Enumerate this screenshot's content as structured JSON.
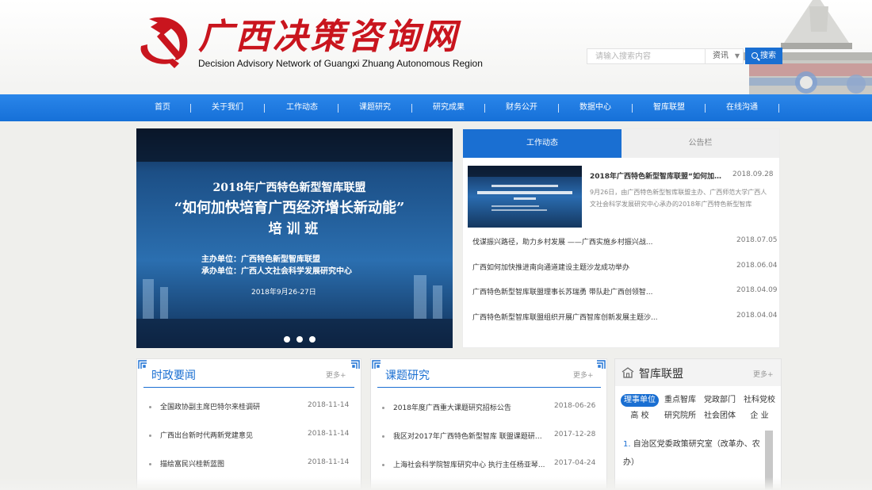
{
  "header": {
    "site_title": "广西决策咨询网",
    "site_subtitle": "Decision Advisory Network of Guangxi Zhuang Autonomous Region",
    "emblem_icon": "hammer-sickle-icon",
    "search": {
      "placeholder": "请输入搜索内容",
      "category": "资讯",
      "button_label": "搜索",
      "button_icon": "search-icon"
    }
  },
  "nav": {
    "items": [
      "首页",
      "关于我们",
      "工作动态",
      "课题研究",
      "研究成果",
      "财务公开",
      "数据中心",
      "智库联盟",
      "在线沟通"
    ]
  },
  "colors": {
    "accent": "#1a6fd2",
    "brand_red": "#c9151e"
  },
  "hero": {
    "line1": "2018年广西特色新型智库联盟",
    "line2": "“如何加快培育广西经济增长新动能”",
    "line3": "培 训 班",
    "line4": "主办单位：广西特色新型智库联盟",
    "line5": "承办单位：广西人文社会科学发展研究中心",
    "line6": "2018年9月26-27日",
    "slide_count": 3
  },
  "news": {
    "tabs": [
      "工作动态",
      "公告栏"
    ],
    "featured": {
      "title": "2018年广西特色新型智库联盟“如何加快培...",
      "date": "2018.09.28",
      "summary": "9月26日，由广西特色新型智库联盟主办、广西师范大学广西人文社会科学发展研究中心承办的2018年广西特色新型智库"
    },
    "items": [
      {
        "title": "伐谋振兴路径，助力乡村发展 ——广西实施乡村振兴战...",
        "date": "2018.07.05"
      },
      {
        "title": "广西如何加快推进南向通道建设主题沙龙成功举办",
        "date": "2018.06.04"
      },
      {
        "title": "广西特色新型智库联盟理事长苏瑞勇 带队赴广西创领智...",
        "date": "2018.04.09"
      },
      {
        "title": "广西特色新型智库联盟组织开展广西智库创新发展主题沙...",
        "date": "2018.04.04"
      }
    ]
  },
  "politics": {
    "title": "时政要闻",
    "more": "更多+",
    "items": [
      {
        "title": "全国政协副主席巴特尔来桂调研",
        "date": "2018-11-14"
      },
      {
        "title": "广西出台新时代两新党建意见",
        "date": "2018-11-14"
      },
      {
        "title": "描绘富民兴桂新蓝图",
        "date": "2018-11-14"
      }
    ]
  },
  "research": {
    "title": "课题研究",
    "more": "更多+",
    "items": [
      {
        "title": "2018年度广西重大课题研究招标公告",
        "date": "2018-06-26"
      },
      {
        "title": "我区对2017年广西特色新型智库 联盟课题研究...",
        "date": "2017-12-28"
      },
      {
        "title": "上海社会科学院智库研究中心 执行主任杨亚琴...",
        "date": "2017-04-24"
      }
    ]
  },
  "think_tank": {
    "title": "智库联盟",
    "more": "更多+",
    "icon": "building-icon",
    "tabs_row1": [
      "理事单位",
      "重点智库",
      "党政部门",
      "社科党校"
    ],
    "tabs_row2": [
      "高 校",
      "研究院所",
      "社会团体",
      "企 业"
    ],
    "active_tab": "理事单位",
    "item_number": "1.",
    "item_text": "自治区党委政策研究室（改革办、农办）"
  }
}
